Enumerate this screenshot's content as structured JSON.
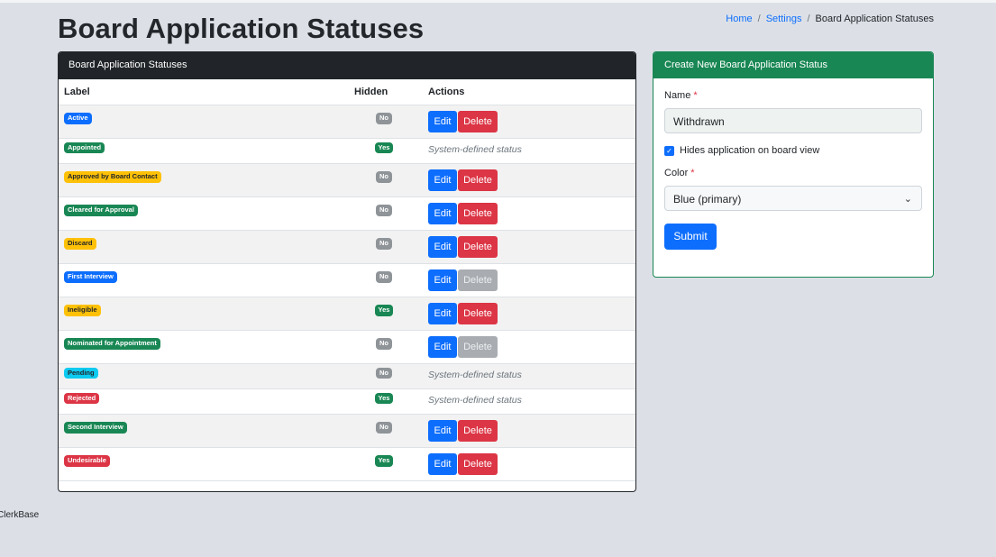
{
  "page": {
    "title": "Board Application Statuses",
    "breadcrumb": [
      "Home",
      "Settings",
      "Board Application Statuses"
    ]
  },
  "list_card": {
    "header": "Board Application Statuses",
    "columns": [
      "Label",
      "Hidden",
      "Actions"
    ],
    "rows": [
      {
        "label": "Active",
        "color": "primary",
        "hidden": "No",
        "actions": "edit_delete",
        "delete_enabled": true
      },
      {
        "label": "Appointed",
        "color": "success",
        "hidden": "Yes",
        "actions": "system",
        "delete_enabled": false
      },
      {
        "label": "Approved by Board Contact",
        "color": "warning",
        "hidden": "No",
        "actions": "edit_delete",
        "delete_enabled": true
      },
      {
        "label": "Cleared for Approval",
        "color": "success",
        "hidden": "No",
        "actions": "edit_delete",
        "delete_enabled": true
      },
      {
        "label": "Discard",
        "color": "warning",
        "hidden": "No",
        "actions": "edit_delete",
        "delete_enabled": true
      },
      {
        "label": "First Interview",
        "color": "primary",
        "hidden": "No",
        "actions": "edit_delete",
        "delete_enabled": false
      },
      {
        "label": "Ineligible",
        "color": "warning",
        "hidden": "Yes",
        "actions": "edit_delete",
        "delete_enabled": true
      },
      {
        "label": "Nominated for Appointment",
        "color": "success",
        "hidden": "No",
        "actions": "edit_delete",
        "delete_enabled": false
      },
      {
        "label": "Pending",
        "color": "info",
        "hidden": "No",
        "actions": "system",
        "delete_enabled": false
      },
      {
        "label": "Rejected",
        "color": "danger",
        "hidden": "Yes",
        "actions": "system",
        "delete_enabled": false
      },
      {
        "label": "Second Interview",
        "color": "success",
        "hidden": "No",
        "actions": "edit_delete",
        "delete_enabled": true
      },
      {
        "label": "Undesirable",
        "color": "danger",
        "hidden": "Yes",
        "actions": "edit_delete",
        "delete_enabled": true
      }
    ],
    "edit_label": "Edit",
    "delete_label": "Delete",
    "system_label": "System-defined status"
  },
  "form_card": {
    "header": "Create New Board Application Status",
    "name_label": "Name",
    "required_mark": "*",
    "name_value": "Withdrawn",
    "checkbox_label": "Hides application on board view",
    "checkbox_checked": true,
    "color_label": "Color",
    "color_value": "Blue (primary)",
    "submit_label": "Submit"
  },
  "footer": {
    "brand": "ClerkBase"
  },
  "colors": {
    "primary": "#0d6efd",
    "success": "#198754",
    "warning": "#ffc107",
    "info": "#0dcaf0",
    "danger": "#dc3545",
    "secondary": "#8f9499",
    "dark": "#212529",
    "background": "#dce0e6"
  }
}
